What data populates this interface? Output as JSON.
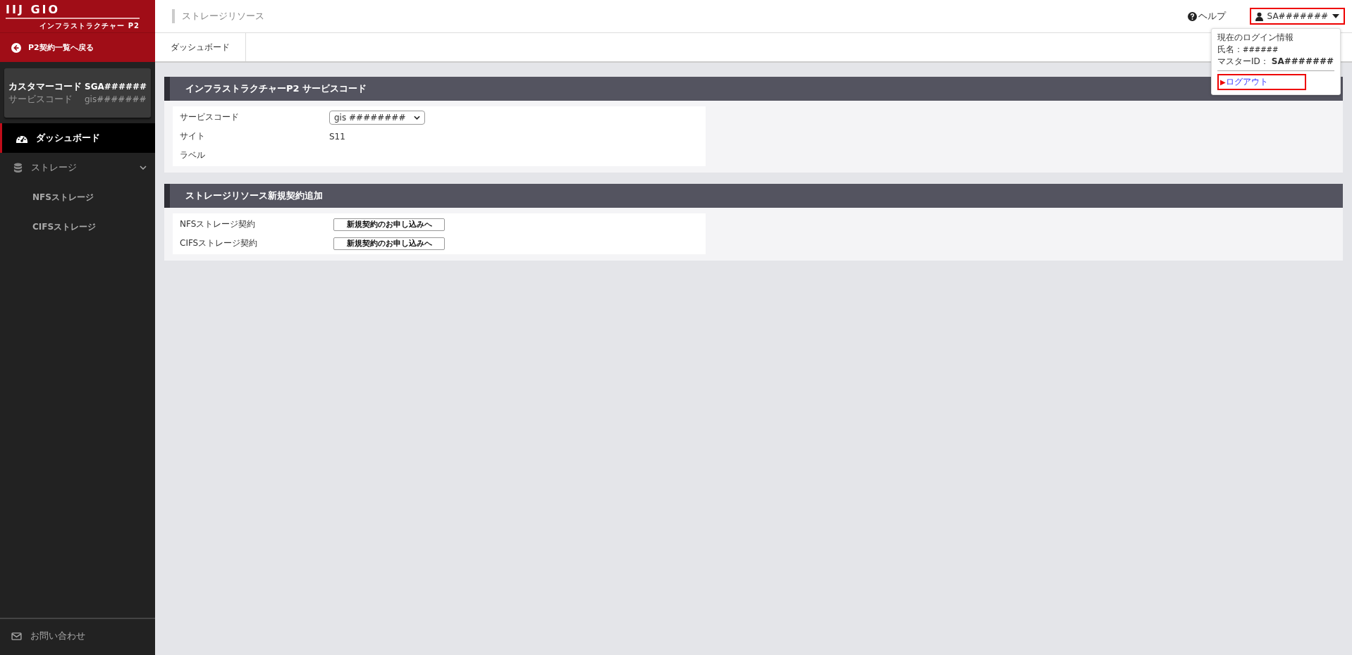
{
  "logo": {
    "brand": "IIJ GIO",
    "product": "インフラストラクチャー P2"
  },
  "back_link": "P2契約一覧へ戻る",
  "customer_card": [
    {
      "label": "カスタマーコード",
      "value": "SGA######"
    },
    {
      "label": "サービスコード",
      "value": "gis#######"
    }
  ],
  "sidebar": {
    "items": [
      {
        "label": "ダッシュボード",
        "kind": "gauge",
        "selected": true
      },
      {
        "label": "ストレージ",
        "kind": "database",
        "selected": false,
        "expanded": true,
        "children": [
          {
            "label": "NFSストレージ",
            "selected": false
          },
          {
            "label": "CIFSストレージ",
            "selected": false
          }
        ]
      }
    ],
    "contact": "お問い合わせ"
  },
  "header": {
    "title": "ストレージリソース",
    "help": "ヘルプ",
    "user": "SA#######"
  },
  "user_menu": {
    "heading": "現在のログイン情報",
    "name_label": "氏名：",
    "name": "######",
    "id_label": "マスターID：",
    "id": "SA#######",
    "logout_marker": "▶",
    "logout": "ログアウト"
  },
  "tabs": [
    {
      "label": "ダッシュボード",
      "selected": true
    }
  ],
  "panels": [
    {
      "title": "インフラストラクチャーP2 サービスコード",
      "rows": [
        {
          "label": "サービスコード",
          "kind": "select",
          "value": "gis ########"
        },
        {
          "label": "サイト",
          "kind": "text",
          "value": "S11"
        },
        {
          "label": "ラベル",
          "kind": "text"
        }
      ]
    },
    {
      "title": "ストレージリソース新規契約追加",
      "rows": [
        {
          "label": "NFSストレージ契約",
          "kind": "button",
          "value": "新規契約のお申し込みへ"
        },
        {
          "label": "CIFSストレージ契約",
          "kind": "button",
          "value": "新規契約のお申し込みへ"
        }
      ]
    }
  ]
}
